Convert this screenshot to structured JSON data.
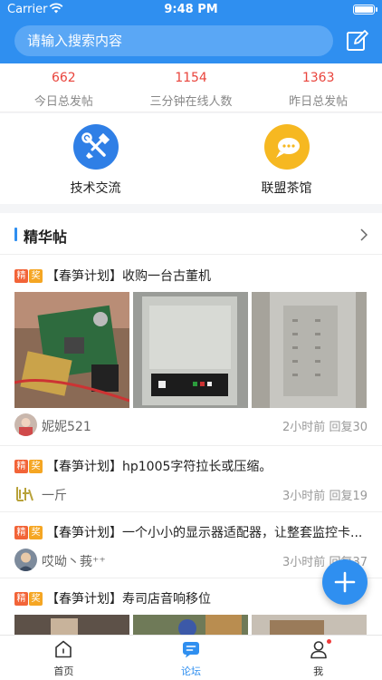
{
  "status": {
    "carrier": "Carrier",
    "time": "9:48 PM"
  },
  "search": {
    "placeholder": "请输入搜索内容"
  },
  "stats": [
    {
      "value": "662",
      "label": "今日总发帖"
    },
    {
      "value": "1154",
      "label": "三分钟在线人数"
    },
    {
      "value": "1363",
      "label": "昨日总发帖"
    }
  ],
  "categories": [
    {
      "label": "技术交流",
      "icon": "tools-icon",
      "color": "#2f7fe6"
    },
    {
      "label": "联盟茶馆",
      "icon": "chat-bubble-icon",
      "color": "#f6b821"
    }
  ],
  "section": {
    "title": "精华帖"
  },
  "badges": {
    "jing": "精",
    "jiang": "奖"
  },
  "posts": [
    {
      "title": "【春笋计划】收购一台古董机",
      "author": "妮妮521",
      "time": "2小时前",
      "replies": "回复30"
    },
    {
      "title": "【春笋计划】hp1005字符拉长或压缩。",
      "author": "一斤",
      "time": "3小时前",
      "replies": "回复19"
    },
    {
      "title": "【春笋计划】一个小小的显示器适配器，让整套监控卡...",
      "author": "哎呦丶莪⁺⁺",
      "time": "3小时前",
      "replies": "回复37"
    },
    {
      "title": "【春笋计划】寿司店音响移位",
      "author": "",
      "time": "",
      "replies": ""
    }
  ],
  "tabs": [
    {
      "label": "首页",
      "icon": "home-icon"
    },
    {
      "label": "论坛",
      "icon": "forum-icon",
      "active": true
    },
    {
      "label": "我",
      "icon": "user-icon"
    }
  ],
  "colors": {
    "accent": "#2f8ff0",
    "stat_number": "#e9443c",
    "badge_jing": "#f26438",
    "badge_jiang": "#f5a623"
  }
}
